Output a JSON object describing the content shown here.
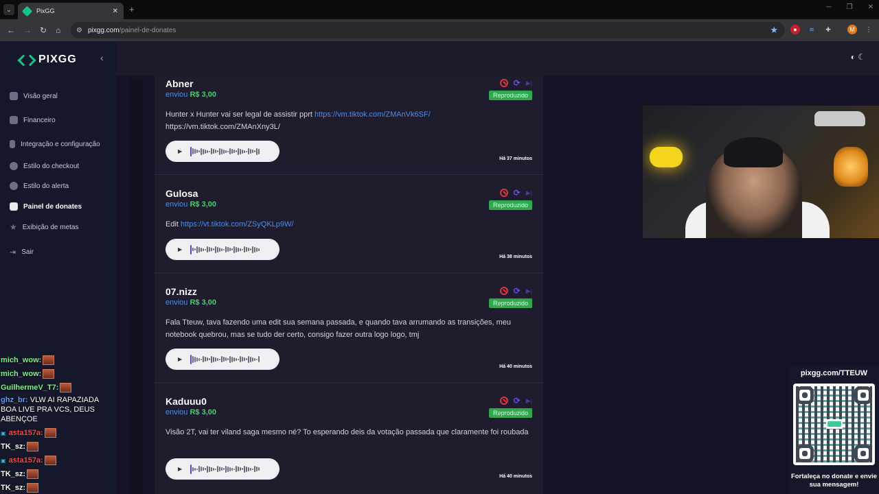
{
  "browser": {
    "tab_title": "PixGG",
    "tab_close": "✕",
    "new_tab": "+",
    "url_host": "pixgg.com",
    "url_path": "/painel-de-donates",
    "profile_initial": "M"
  },
  "sidebar": {
    "logo": "PIXGG",
    "items": [
      {
        "label": "Visão geral",
        "icon": "home-icon"
      },
      {
        "label": "Financeiro",
        "icon": "wallet-icon"
      },
      {
        "label": "Integração e configuração",
        "icon": "plug-icon"
      },
      {
        "label": "Estilo do checkout",
        "icon": "palette-icon"
      },
      {
        "label": "Estilo do alerta",
        "icon": "palette-icon"
      },
      {
        "label": "Painel de donates",
        "icon": "hand-coins-icon"
      },
      {
        "label": "Exibição de metas",
        "icon": "star-icon"
      },
      {
        "label": "Sair",
        "icon": "logout-icon"
      }
    ],
    "active": "Painel de donates"
  },
  "donations": [
    {
      "name": "Abner",
      "sent_label": "enviou",
      "amount": "R$ 3,00",
      "status": "Reproduzido",
      "message_text": "Hunter x Hunter vai ser legal de assistir pprt ",
      "message_link": "https://vm.tiktok.com/ZMAnVk6SF/",
      "message_tail": "https://vm.tiktok.com/ZMAnXny3L/",
      "time": "Há 37 minutos"
    },
    {
      "name": "Gulosa",
      "sent_label": "enviou",
      "amount": "R$ 3,00",
      "status": "Reproduzido",
      "message_text": "Edit ",
      "message_link": "https://vt.tiktok.com/ZSyQKLp9W/",
      "message_tail": "",
      "time": "Há 38 minutos"
    },
    {
      "name": "07.nizz",
      "sent_label": "enviou",
      "amount": "R$ 3,00",
      "status": "Reproduzido",
      "message_text": "Fala Tteuw, tava fazendo uma edit sua semana passada, e quando tava arrumando as transições, meu notebook quebrou, mas se tudo der certo, consigo fazer outra logo logo, tmj",
      "message_link": "",
      "message_tail": "",
      "time": "Há 40 minutos"
    },
    {
      "name": "Kaduuu0",
      "sent_label": "enviou",
      "amount": "R$ 3,00",
      "status": "Reproduzido",
      "message_text": "Visão 2T, vai ter viland saga mesmo né? To esperando deis da votação passada que claramente foi roubada",
      "message_link": "",
      "message_tail": "",
      "time": "Há 40 minutos"
    }
  ],
  "chat": [
    {
      "user": "mich_wow:",
      "color": "green",
      "text": ""
    },
    {
      "user": "mich_wow:",
      "color": "green",
      "text": ""
    },
    {
      "user": "GuilhermeV_T7:",
      "color": "green",
      "text": ""
    },
    {
      "user": "ghz_br:",
      "color": "blue",
      "text": "VLW AI RAPAZIADA BOA LIVE PRA VCS, DEUS ABENÇOE"
    },
    {
      "user": "asta157a:",
      "color": "red",
      "text": ""
    },
    {
      "user": "TK_sz:",
      "color": "white",
      "text": ""
    },
    {
      "user": "asta157a:",
      "color": "red",
      "text": ""
    },
    {
      "user": "TK_sz:",
      "color": "white",
      "text": ""
    },
    {
      "user": "TK_sz:",
      "color": "white",
      "text": ""
    }
  ],
  "qr_panel": {
    "url": "pixgg.com/TTEUW",
    "caption": "Fortaleça no donate e envie sua mensagem!"
  },
  "colors": {
    "accent": "#19c28a",
    "link": "#4c8eea",
    "amount": "#3ed26a",
    "badge": "#2fa84f",
    "danger": "#e0343f"
  }
}
